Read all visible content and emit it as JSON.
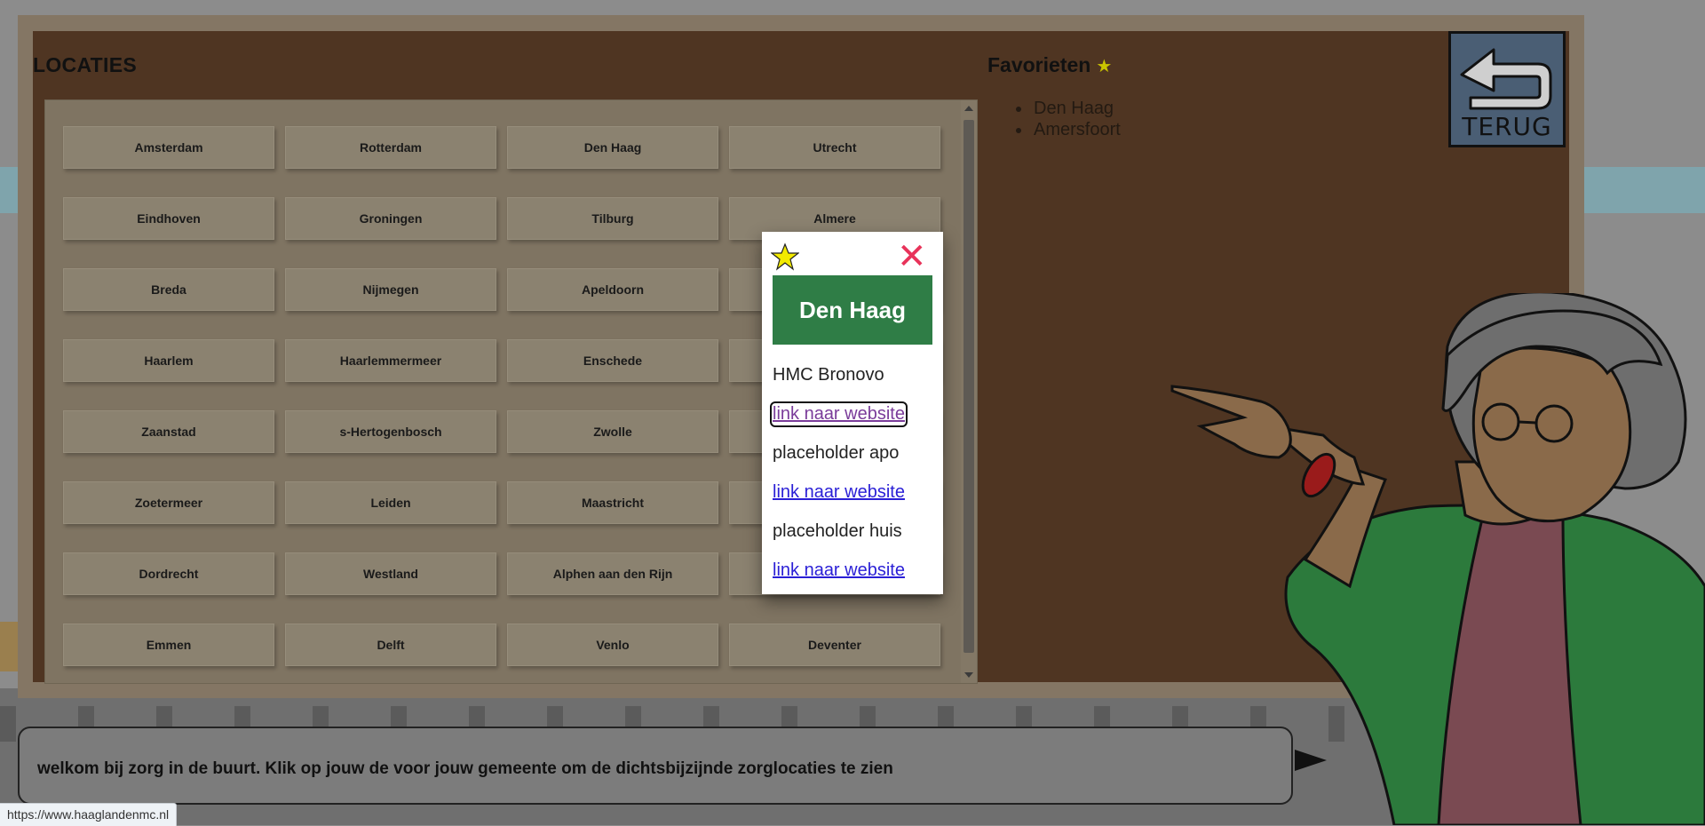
{
  "locaties": {
    "title": "LOCATIES",
    "cities": [
      "Amsterdam",
      "Rotterdam",
      "Den Haag",
      "Utrecht",
      "Eindhoven",
      "Groningen",
      "Tilburg",
      "Almere",
      "Breda",
      "Nijmegen",
      "Apeldoorn",
      "",
      "Haarlem",
      "Haarlemmermeer",
      "Enschede",
      "",
      "Zaanstad",
      "s-Hertogenbosch",
      "Zwolle",
      "",
      "Zoetermeer",
      "Leiden",
      "Maastricht",
      "",
      "Dordrecht",
      "Westland",
      "Alphen aan den Rijn",
      "",
      "Emmen",
      "Delft",
      "Venlo",
      "Deventer"
    ]
  },
  "favorieten": {
    "title": "Favorieten",
    "star": "★",
    "items": [
      "Den Haag",
      "Amersfoort"
    ]
  },
  "terug": {
    "label": "TERUG"
  },
  "popup": {
    "city": "Den Haag",
    "close": "✕",
    "entries": [
      {
        "name": "HMC Bronovo",
        "link": "link naar website"
      },
      {
        "name": "placeholder apo",
        "link": "link naar website"
      },
      {
        "name": "placeholder huis",
        "link": "link naar website"
      }
    ]
  },
  "speech": {
    "text": "welkom bij zorg in de buurt. Klik op jouw de voor jouw gemeente om de dichtsbijzijnde zorglocaties te zien"
  },
  "status_url": "https://www.haaglandenmc.nl",
  "colors": {
    "popup_header": "#2f7d46",
    "close_icon": "#e8335a",
    "link": "#2a1fd6",
    "visited_link": "#7a3c9a",
    "board": "#4f3522"
  }
}
